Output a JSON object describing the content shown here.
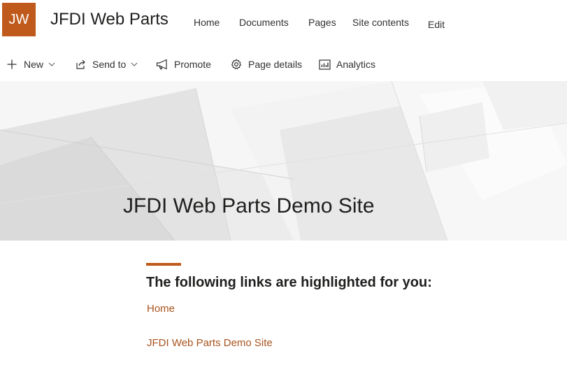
{
  "header": {
    "logo_initials": "JW",
    "site_title": "JFDI Web Parts",
    "nav": [
      "Home",
      "Documents",
      "Pages",
      "Site contents",
      "Edit"
    ]
  },
  "commandbar": {
    "new_label": "New",
    "send_to_label": "Send to",
    "promote_label": "Promote",
    "page_details_label": "Page details",
    "analytics_label": "Analytics"
  },
  "hero": {
    "title": "JFDI Web Parts Demo Site"
  },
  "quick_links": {
    "heading": "The following links are highlighted for you:",
    "links": [
      "Home",
      "JFDI Web Parts Demo Site"
    ]
  },
  "colors": {
    "accent": "#c05a1c",
    "link": "#a9541e"
  },
  "icons": [
    "plus-icon",
    "send-icon",
    "promote-megaphone-icon",
    "gear-icon",
    "analytics-chart-icon",
    "chevron-down-icon"
  ]
}
